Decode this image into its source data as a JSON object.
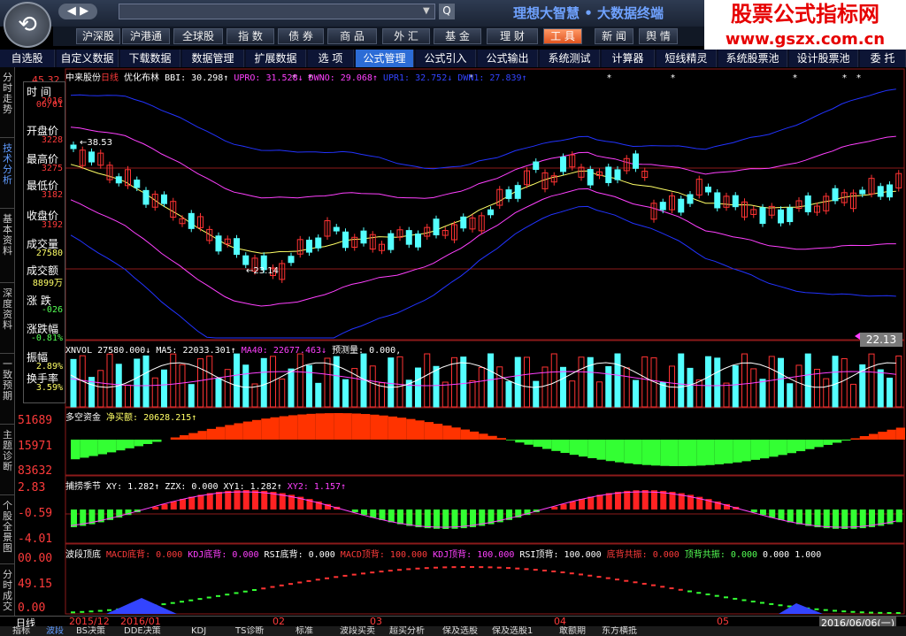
{
  "app": {
    "brand_text": "理想大智慧 • 大数据终端",
    "watermark_line1": "股票公式指标网",
    "watermark_line2": "www.gszx.com.cn",
    "nav_back": "◀",
    "nav_forward": "▶",
    "search_button": "Q"
  },
  "market_tabs": [
    "沪深股",
    "沪港通",
    "全球股",
    "指 数",
    "债 券",
    "商 品",
    "外 汇",
    "基 金",
    "理 财",
    "工 具",
    "新 闻",
    "舆 情"
  ],
  "market_tabs_active": "工 具",
  "func_tabs": [
    "自选股",
    "自定义数据",
    "下载数据",
    "数据管理",
    "扩展数据",
    "选 项",
    "公式管理",
    "公式引入",
    "公式输出",
    "系统测试",
    "计算器",
    "短线精灵",
    "系统股票池",
    "设计股票池",
    "委 托"
  ],
  "func_tabs_active": "公式管理",
  "vertical_tabs": [
    "分时走势",
    "技术分析",
    "基本资料",
    "深度资料",
    "一致预期",
    "主题诊断",
    "个股全景图",
    "分时成交"
  ],
  "vertical_tabs_active": "技术分析",
  "info_panel": {
    "rows": [
      {
        "label": "时 间",
        "value": "2016"
      },
      {
        "label": "",
        "value": "06/01"
      },
      {
        "label": "开盘价",
        "value": "3228"
      },
      {
        "label": "最高价",
        "value": "3275"
      },
      {
        "label": "最低价",
        "value": "3182"
      },
      {
        "label": "收盘价",
        "value": "3192"
      },
      {
        "label": "成交量",
        "value": "27580"
      },
      {
        "label": "成交额",
        "value": "8899万"
      },
      {
        "label": "涨 跌",
        "value": "-026"
      },
      {
        "label": "涨跌幅",
        "value": "-0.81%"
      },
      {
        "label": "振幅",
        "value": "2.89%"
      },
      {
        "label": "换手率",
        "value": "3.59%"
      }
    ]
  },
  "main_legend": {
    "stock": "中来股份",
    "period": "日线",
    "indicator": "优化布林",
    "bbi_label": "BBI: 30.298↑",
    "upr_label": "UPRO: 31.528↓",
    "dwn_label": "DWNO: 29.068↑",
    "upr1_label": "UPR1: 32.752↓",
    "dwn1_label": "DWN1: 27.839↑",
    "top_price": "45.32",
    "high_tag": "38.53",
    "low_tag": "23.14",
    "price_tag": "22.13"
  },
  "vol_legend": {
    "xnvol": "XNVOL 27580.000↓",
    "ma5": "MA5: 22033.301↑",
    "ma40": "MA40: 22677.463↓",
    "forecast": "预测量: 0.000,"
  },
  "dk_legend": {
    "name": "多空资金",
    "net": "净买额: 20628.215↑",
    "ticks": [
      "51689",
      "15971",
      "83632"
    ]
  },
  "bz_legend": {
    "name": "捕捞季节",
    "xy": "XY: 1.282↑",
    "zzx": "ZZX: 0.000",
    "xy1": "XY1: 1.282↑",
    "xy2": "XY2: 1.157↑",
    "ticks": [
      "2.83",
      "-0.59",
      "-4.01"
    ]
  },
  "bd_legend": {
    "name": "波段顶底",
    "items": [
      "MACD底背: 0.000",
      "KDJ底背: 0.000",
      "RSI底背: 0.000",
      "MACD顶背: 100.000",
      "KDJ顶背: 100.000",
      "RSI顶背: 100.000",
      "底背共振: 0.000",
      "顶背共振: 0.000",
      "0.000",
      "1.000"
    ],
    "ticks": [
      "00.00",
      "49.15",
      "0.00"
    ]
  },
  "date_axis": {
    "period_label": "日线",
    "labels": [
      "2015/12",
      "2016/01",
      "02",
      "03",
      "04",
      "05"
    ],
    "cursor_date": "2016/06/06(一)"
  },
  "bottom_tabs": [
    "指标",
    "波段",
    "BS决策",
    "DDE决策",
    "KDJ",
    "TS诊断",
    "标准",
    "波段买卖",
    "超买分析",
    "保及选股",
    "保及选股1",
    "敢额期",
    "东方横抵"
  ],
  "bottom_tabs_active": "波段",
  "colors": {
    "bg": "#000000",
    "up": "#ff3333",
    "down": "#54ffff",
    "bbi": "#ffff66",
    "upr": "#ff40ff",
    "upr1": "#2233ff",
    "legend_text": "#ffffff"
  },
  "chart_data": {
    "type": "candlestick",
    "series": [
      {
        "name": "BBI",
        "last": 30.298
      },
      {
        "name": "UPRO",
        "last": 31.528
      },
      {
        "name": "DWNO",
        "last": 29.068
      },
      {
        "name": "UPR1",
        "last": 32.752
      },
      {
        "name": "DWN1",
        "last": 27.839
      }
    ],
    "last_close": 22.13,
    "high_marker": 38.53,
    "low_marker": 23.14,
    "volume_last": 27580,
    "ma5": 22033.301,
    "ma40": 22677.463
  }
}
